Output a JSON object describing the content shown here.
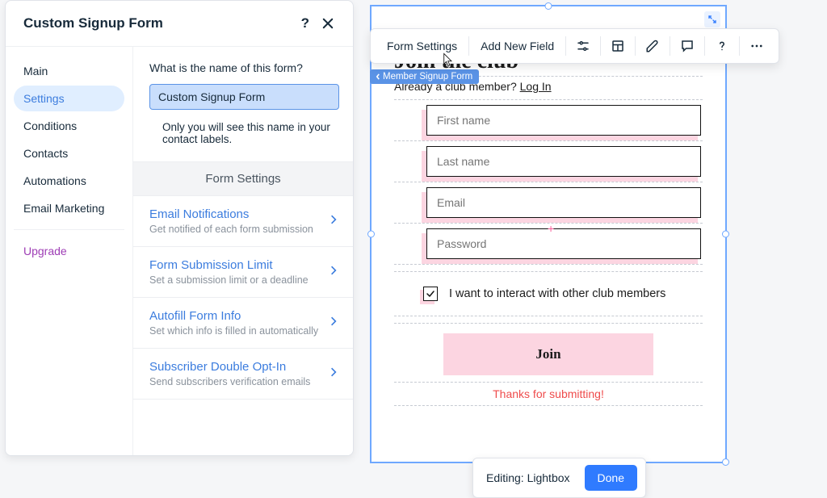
{
  "panel": {
    "title": "Custom Signup Form",
    "help": "?",
    "sidebar": {
      "items": [
        {
          "label": "Main",
          "active": false
        },
        {
          "label": "Settings",
          "active": true
        },
        {
          "label": "Conditions",
          "active": false
        },
        {
          "label": "Contacts",
          "active": false
        },
        {
          "label": "Automations",
          "active": false
        },
        {
          "label": "Email Marketing",
          "active": false
        }
      ],
      "upgrade": "Upgrade"
    },
    "content": {
      "question": "What is the name of this form?",
      "formNameValue": "Custom Signup Form",
      "helper": "Only you will see this name in your contact labels.",
      "sectionHeader": "Form Settings",
      "rows": [
        {
          "title": "Email Notifications",
          "sub": "Get notified of each form submission"
        },
        {
          "title": "Form Submission Limit",
          "sub": "Set a submission limit or a deadline"
        },
        {
          "title": "Autofill Form Info",
          "sub": "Set which info is filled in automatically"
        },
        {
          "title": "Subscriber Double Opt-In",
          "sub": "Send subscribers verification emails"
        }
      ]
    }
  },
  "toolbar": {
    "formSettings": "Form Settings",
    "addNewField": "Add New Field"
  },
  "selectionTag": "Member Signup Form",
  "canvas": {
    "title": "Join the club",
    "alreadyPrefix": "Already a club member? ",
    "loginLink": "Log In",
    "fields": {
      "first": "First name",
      "last": "Last name",
      "email": "Email",
      "password": "Password"
    },
    "checkbox": "I want to interact with other club members",
    "joinBtn": "Join",
    "thanks": "Thanks for submitting!"
  },
  "editBar": {
    "label": "Editing: Lightbox",
    "done": "Done"
  }
}
